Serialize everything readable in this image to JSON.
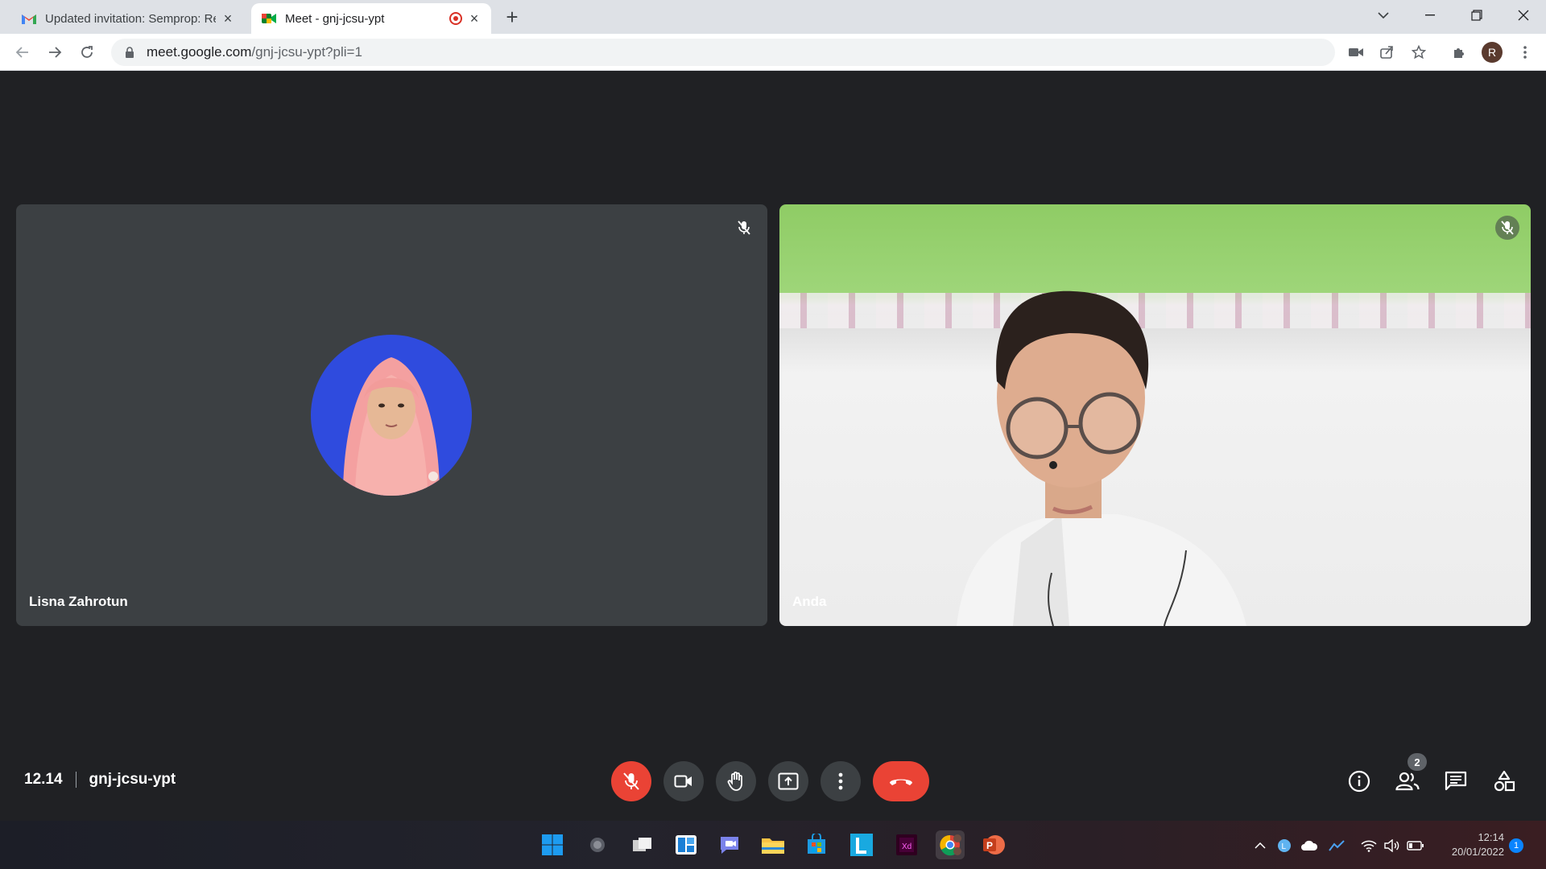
{
  "browser": {
    "tabs": [
      {
        "title": "Updated invitation: Semprop: Re",
        "icon": "gmail-icon"
      },
      {
        "title": "Meet - gnj-jcsu-ypt",
        "icon": "meet-icon",
        "recording": true
      }
    ],
    "url_host": "meet.google.com",
    "url_path": "/gnj-jcsu-ypt?pli=1",
    "profile_initial": "R"
  },
  "meeting": {
    "time": "12.14",
    "code": "gnj-jcsu-ypt",
    "participants_count": "2",
    "tiles": [
      {
        "name": "Lisna Zahrotun",
        "muted": true,
        "camera": false
      },
      {
        "name": "Anda",
        "muted": true,
        "camera": true
      }
    ]
  },
  "taskbar": {
    "clock_time": "12:14",
    "clock_date": "20/01/2022",
    "notification_count": "1"
  },
  "colors": {
    "meet_bg": "#202124",
    "tile_bg": "#3c4043",
    "danger": "#ea4335",
    "avatar_bg": "#2f4bde"
  }
}
